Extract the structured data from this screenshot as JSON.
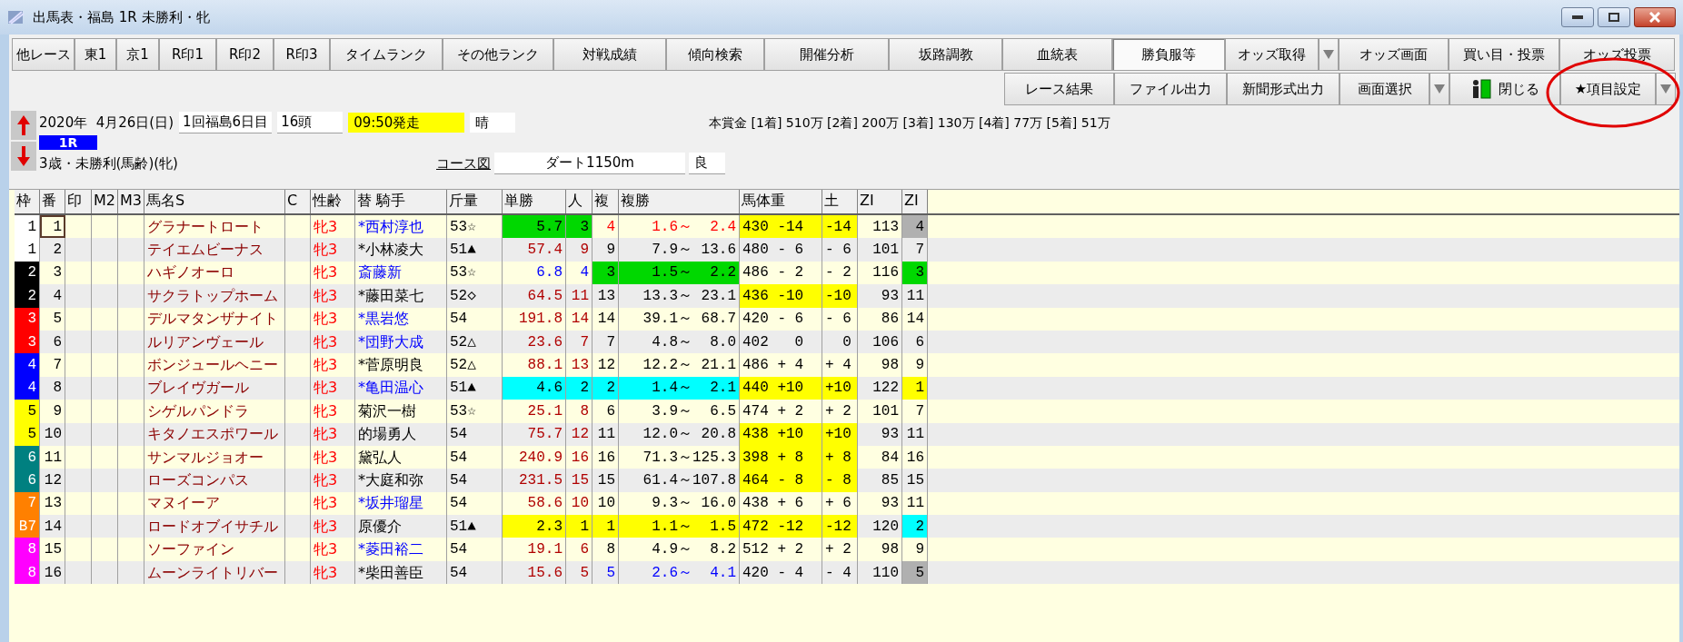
{
  "window": {
    "title": "出馬表・福島 1R 未勝利・牝"
  },
  "toolbar": {
    "row1": [
      {
        "label": "他レース",
        "kind": "plain",
        "pressed": false
      },
      {
        "label": "東1",
        "kind": "plain",
        "pressed": false
      },
      {
        "label": "京1",
        "kind": "plain",
        "pressed": false
      },
      {
        "label": "R印1",
        "kind": "plain",
        "pressed": false
      },
      {
        "label": "R印2",
        "kind": "plain",
        "pressed": false
      },
      {
        "label": "R印3",
        "kind": "plain",
        "pressed": false
      },
      {
        "label": "タイムランク",
        "kind": "plain",
        "pressed": false
      },
      {
        "label": "その他ランク",
        "kind": "plain",
        "pressed": false
      },
      {
        "label": "対戦成績",
        "kind": "plain",
        "pressed": false
      },
      {
        "label": "傾向検索",
        "kind": "plain",
        "pressed": false
      },
      {
        "label": "開催分析",
        "kind": "plain",
        "pressed": false
      },
      {
        "label": "坂路調教",
        "kind": "plain",
        "pressed": false
      },
      {
        "label": "血統表",
        "kind": "plain",
        "pressed": false
      },
      {
        "label": "勝負服等",
        "kind": "plain",
        "pressed": true
      },
      {
        "label": "オッズ取得",
        "kind": "dropdown",
        "pressed": false
      },
      {
        "label": "オッズ画面",
        "kind": "plain",
        "pressed": false
      },
      {
        "label": "買い目・投票",
        "kind": "plain",
        "pressed": false
      },
      {
        "label": "オッズ投票",
        "kind": "plain",
        "pressed": false
      }
    ],
    "row2": [
      {
        "label": "レース結果",
        "kind": "plain",
        "pressed": false
      },
      {
        "label": "ファイル出力",
        "kind": "plain",
        "pressed": false
      },
      {
        "label": "新聞形式出力",
        "kind": "plain",
        "pressed": false
      },
      {
        "label": "画面選択",
        "kind": "dropdown",
        "pressed": false
      },
      {
        "label": "閉じる",
        "kind": "exit",
        "pressed": false
      },
      {
        "label": "★項目設定",
        "kind": "dropdown",
        "pressed": false
      }
    ]
  },
  "race": {
    "date": "2020年  4月26日(日)",
    "meeting": "1回福島6日目",
    "runners": "16頭",
    "post_time": {
      "text": "09:50発走",
      "highlight": true
    },
    "weather": "晴",
    "prize": "本賞金 [1着] 510万 [2着] 200万 [3着] 130万 [4着] 77万 [5着] 51万",
    "race_number": "1R",
    "conditions": "3歳・未勝利(馬齢)(牝)",
    "course_link": "コース図",
    "course": "ダート1150m",
    "going": "良"
  },
  "table": {
    "columns": [
      {
        "label": "枠"
      },
      {
        "label": "番"
      },
      {
        "label": "印"
      },
      {
        "label": "M2"
      },
      {
        "label": "M3"
      },
      {
        "label": "馬名S"
      },
      {
        "label": "C"
      },
      {
        "label": "性齢"
      },
      {
        "label": "替 騎手"
      },
      {
        "label": "斤量"
      },
      {
        "label": "単勝"
      },
      {
        "label": "人"
      },
      {
        "label": "複"
      },
      {
        "label": "複勝"
      },
      {
        "label": "馬体重"
      },
      {
        "label": "土"
      },
      {
        "label": "ZI"
      },
      {
        "label": "ZI"
      }
    ],
    "rows": [
      {
        "selected": true,
        "frame": {
          "text": "1",
          "color": "#ffffff"
        },
        "number": "1",
        "name": "グラナートロート",
        "sex_age": "牝3",
        "jockey": {
          "text": "*西村淳也",
          "color": "#0000ff"
        },
        "weight": "53☆",
        "win_odds": {
          "text": "5.7",
          "highlight": {
            "color": "#00d800"
          }
        },
        "win_rank": {
          "text": "3",
          "highlight": {
            "color": "#00d800"
          }
        },
        "place_rank": {
          "text": "4",
          "color": "#ff0000"
        },
        "place_odds": {
          "text": " 1.6～  2.4",
          "color": "#ff0000"
        },
        "body_weight": {
          "text": "430 -14",
          "highlight": {
            "color": "#ffff00"
          }
        },
        "diff": {
          "text": "-14",
          "highlight": {
            "color": "#ffff00"
          }
        },
        "zi": "113",
        "zi_rank": {
          "text": "4",
          "highlight": {
            "color": "#b0b0b0"
          }
        }
      },
      {
        "selected": false,
        "frame": {
          "text": "1",
          "color": "#ffffff"
        },
        "number": "2",
        "name": "テイエムビーナス",
        "sex_age": "牝3",
        "jockey": "*小林凌大",
        "weight": "51▲",
        "win_odds": {
          "text": "57.4",
          "color": "#b00000"
        },
        "win_rank": {
          "text": "9",
          "color": "#b00000"
        },
        "place_rank": "9",
        "place_odds": " 7.9～ 13.6",
        "body_weight": "480 - 6",
        "diff": "- 6",
        "zi": "101",
        "zi_rank": "7"
      },
      {
        "selected": false,
        "frame": {
          "text": "2",
          "color": "#000000"
        },
        "number": "3",
        "name": "ハギノオーロ",
        "sex_age": "牝3",
        "jockey": {
          "text": "斎藤新",
          "color": "#0000ff"
        },
        "weight": "53☆",
        "win_odds": {
          "text": "6.8",
          "color": "#0000ff"
        },
        "win_rank": {
          "text": "4",
          "color": "#0000ff"
        },
        "place_rank": {
          "text": "3",
          "highlight": {
            "color": "#00d800"
          }
        },
        "place_odds": {
          "text": " 1.5～  2.2",
          "highlight": {
            "color": "#00d800"
          }
        },
        "body_weight": "486 - 2",
        "diff": "- 2",
        "zi": "116",
        "zi_rank": {
          "text": "3",
          "highlight": {
            "color": "#00d800"
          }
        }
      },
      {
        "selected": false,
        "frame": {
          "text": "2",
          "color": "#000000"
        },
        "number": "4",
        "name": "サクラトップホーム",
        "sex_age": "牝3",
        "jockey": "*藤田菜七",
        "weight": "52◇",
        "win_odds": {
          "text": "64.5",
          "color": "#b00000"
        },
        "win_rank": {
          "text": "11",
          "color": "#b00000"
        },
        "place_rank": "13",
        "place_odds": "13.3～ 23.1",
        "body_weight": {
          "text": "436 -10",
          "highlight": {
            "color": "#ffff00"
          }
        },
        "diff": {
          "text": "-10",
          "highlight": {
            "color": "#ffff00"
          }
        },
        "zi": "93",
        "zi_rank": "11"
      },
      {
        "selected": false,
        "frame": {
          "text": "3",
          "color": "#ff0000"
        },
        "number": "5",
        "name": "デルマタンザナイト",
        "sex_age": "牝3",
        "jockey": {
          "text": "*黒岩悠",
          "color": "#0000ff"
        },
        "weight": "54",
        "win_odds": {
          "text": "191.8",
          "color": "#b00000"
        },
        "win_rank": {
          "text": "14",
          "color": "#b00000"
        },
        "place_rank": "14",
        "place_odds": "39.1～ 68.7",
        "body_weight": "420 - 6",
        "diff": "- 6",
        "zi": "86",
        "zi_rank": "14"
      },
      {
        "selected": false,
        "frame": {
          "text": "3",
          "color": "#ff0000"
        },
        "number": "6",
        "name": "ルリアンヴェール",
        "sex_age": "牝3",
        "jockey": {
          "text": "*団野大成",
          "color": "#0000ff"
        },
        "weight": "52△",
        "win_odds": {
          "text": "23.6",
          "color": "#b00000"
        },
        "win_rank": {
          "text": "7",
          "color": "#b00000"
        },
        "place_rank": "7",
        "place_odds": " 4.8～  8.0",
        "body_weight": "402   0",
        "diff": "  0",
        "zi": "106",
        "zi_rank": "6"
      },
      {
        "selected": false,
        "frame": {
          "text": "4",
          "color": "#0000ff"
        },
        "number": "7",
        "name": "ボンジュールヘニー",
        "sex_age": "牝3",
        "jockey": "*菅原明良",
        "weight": "52△",
        "win_odds": {
          "text": "88.1",
          "color": "#b00000"
        },
        "win_rank": {
          "text": "13",
          "color": "#b00000"
        },
        "place_rank": "12",
        "place_odds": "12.2～ 21.1",
        "body_weight": "486 + 4",
        "diff": "+ 4",
        "zi": "98",
        "zi_rank": "9"
      },
      {
        "selected": false,
        "frame": {
          "text": "4",
          "color": "#0000ff"
        },
        "number": "8",
        "name": "ブレイヴガール",
        "sex_age": "牝3",
        "jockey": {
          "text": "*亀田温心",
          "color": "#0000ff"
        },
        "weight": "51▲",
        "win_odds": {
          "text": "4.6",
          "highlight": {
            "color": "#00ffff"
          }
        },
        "win_rank": {
          "text": "2",
          "highlight": {
            "color": "#00ffff"
          }
        },
        "place_rank": {
          "text": "2",
          "highlight": {
            "color": "#00ffff"
          }
        },
        "place_odds": {
          "text": " 1.4～  2.1",
          "highlight": {
            "color": "#00ffff"
          }
        },
        "body_weight": {
          "text": "440 +10",
          "highlight": {
            "color": "#ffff00"
          }
        },
        "diff": {
          "text": "+10",
          "highlight": {
            "color": "#ffff00"
          }
        },
        "zi": "122",
        "zi_rank": {
          "text": "1",
          "highlight": {
            "color": "#ffff00"
          }
        }
      },
      {
        "selected": false,
        "frame": {
          "text": "5",
          "color": "#ffff00"
        },
        "number": "9",
        "name": "シゲルパンドラ",
        "sex_age": "牝3",
        "jockey": "菊沢一樹",
        "weight": "53☆",
        "win_odds": {
          "text": "25.1",
          "color": "#b00000"
        },
        "win_rank": {
          "text": "8",
          "color": "#b00000"
        },
        "place_rank": "6",
        "place_odds": " 3.9～  6.5",
        "body_weight": "474 + 2",
        "diff": "+ 2",
        "zi": "101",
        "zi_rank": "7"
      },
      {
        "selected": false,
        "frame": {
          "text": "5",
          "color": "#ffff00"
        },
        "number": "10",
        "name": "キタノエスポワール",
        "sex_age": "牝3",
        "jockey": "的場勇人",
        "weight": "54",
        "win_odds": {
          "text": "75.7",
          "color": "#b00000"
        },
        "win_rank": {
          "text": "12",
          "color": "#b00000"
        },
        "place_rank": "11",
        "place_odds": "12.0～ 20.8",
        "body_weight": {
          "text": "438 +10",
          "highlight": {
            "color": "#ffff00"
          }
        },
        "diff": {
          "text": "+10",
          "highlight": {
            "color": "#ffff00"
          }
        },
        "zi": "93",
        "zi_rank": "11"
      },
      {
        "selected": false,
        "frame": {
          "text": "6",
          "color": "#008080"
        },
        "number": "11",
        "name": "サンマルジョオー",
        "sex_age": "牝3",
        "jockey": "黛弘人",
        "weight": "54",
        "win_odds": {
          "text": "240.9",
          "color": "#b00000"
        },
        "win_rank": {
          "text": "16",
          "color": "#b00000"
        },
        "place_rank": "16",
        "place_odds": "71.3～125.3",
        "body_weight": {
          "text": "398 + 8",
          "highlight": {
            "color": "#ffff00"
          }
        },
        "diff": {
          "text": "+ 8",
          "highlight": {
            "color": "#ffff00"
          }
        },
        "zi": "84",
        "zi_rank": "16"
      },
      {
        "selected": false,
        "frame": {
          "text": "6",
          "color": "#008080"
        },
        "number": "12",
        "name": "ローズコンパス",
        "sex_age": "牝3",
        "jockey": "*大庭和弥",
        "weight": "54",
        "win_odds": {
          "text": "231.5",
          "color": "#b00000"
        },
        "win_rank": {
          "text": "15",
          "color": "#b00000"
        },
        "place_rank": "15",
        "place_odds": "61.4～107.8",
        "body_weight": {
          "text": "464 - 8",
          "highlight": {
            "color": "#ffff00"
          }
        },
        "diff": {
          "text": "- 8",
          "highlight": {
            "color": "#ffff00"
          }
        },
        "zi": "85",
        "zi_rank": "15"
      },
      {
        "selected": false,
        "frame": {
          "text": "7",
          "color": "#ff8000"
        },
        "number": "13",
        "name": "マヌイーア",
        "sex_age": "牝3",
        "jockey": {
          "text": "*坂井瑠星",
          "color": "#0000ff"
        },
        "weight": "54",
        "win_odds": {
          "text": "58.6",
          "color": "#b00000"
        },
        "win_rank": {
          "text": "10",
          "color": "#b00000"
        },
        "place_rank": "10",
        "place_odds": " 9.3～ 16.0",
        "body_weight": "438 + 6",
        "diff": "+ 6",
        "zi": "93",
        "zi_rank": "11"
      },
      {
        "selected": false,
        "frame": {
          "text": "B7",
          "color": "#ff8000"
        },
        "number": "14",
        "name": "ロードオブイサチル",
        "sex_age": "牝3",
        "jockey": "原優介",
        "weight": "51▲",
        "win_odds": {
          "text": "2.3",
          "highlight": {
            "color": "#ffff00"
          }
        },
        "win_rank": {
          "text": "1",
          "highlight": {
            "color": "#ffff00"
          }
        },
        "place_rank": {
          "text": "1",
          "highlight": {
            "color": "#ffff00"
          }
        },
        "place_odds": {
          "text": " 1.1～  1.5",
          "highlight": {
            "color": "#ffff00"
          }
        },
        "body_weight": {
          "text": "472 -12",
          "highlight": {
            "color": "#ffff00"
          }
        },
        "diff": {
          "text": "-12",
          "highlight": {
            "color": "#ffff00"
          }
        },
        "zi": "120",
        "zi_rank": {
          "text": "2",
          "highlight": {
            "color": "#00ffff"
          }
        }
      },
      {
        "selected": false,
        "frame": {
          "text": "8",
          "color": "#ff00ff"
        },
        "number": "15",
        "name": "ソーファイン",
        "sex_age": "牝3",
        "jockey": {
          "text": "*菱田裕二",
          "color": "#0000ff"
        },
        "weight": "54",
        "win_odds": {
          "text": "19.1",
          "color": "#b00000"
        },
        "win_rank": {
          "text": "6",
          "color": "#b00000"
        },
        "place_rank": "8",
        "place_odds": " 4.9～  8.2",
        "body_weight": "512 + 2",
        "diff": "+ 2",
        "zi": "98",
        "zi_rank": "9"
      },
      {
        "selected": false,
        "frame": {
          "text": "8",
          "color": "#ff00ff"
        },
        "number": "16",
        "name": "ムーンライトリバー",
        "sex_age": "牝3",
        "jockey": "*柴田善臣",
        "weight": "54",
        "win_odds": {
          "text": "15.6",
          "color": "#b00000"
        },
        "win_rank": {
          "text": "5",
          "color": "#b00000"
        },
        "place_rank": {
          "text": "5",
          "color": "#0000ff"
        },
        "place_odds": {
          "text": " 2.6～  4.1",
          "color": "#0000ff"
        },
        "body_weight": "420 - 4",
        "diff": "- 4",
        "zi": "110",
        "zi_rank": {
          "text": "5",
          "highlight": {
            "color": "#b0b0b0"
          }
        }
      }
    ]
  }
}
